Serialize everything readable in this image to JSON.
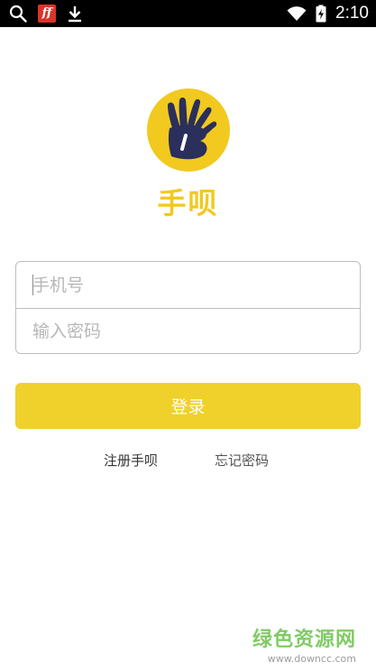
{
  "status_bar": {
    "left_icons": [
      "search-icon",
      "ff-app-icon",
      "download-icon"
    ],
    "ff_badge_text": "ff",
    "right_icons": [
      "wifi-icon",
      "battery-charging-icon"
    ],
    "time": "2:10"
  },
  "colors": {
    "brand_yellow": "#f2c91f",
    "logo_navy": "#2a2f5b",
    "border_gray": "#bdbdbd",
    "placeholder_gray": "#b7b7b7",
    "watermark_green": "#6bc34a"
  },
  "app": {
    "logo_icon": "hand-b-logo-icon",
    "name": "手呗"
  },
  "login_form": {
    "phone_placeholder": "手机号",
    "phone_value": "",
    "password_placeholder": "输入密码",
    "password_value": "",
    "submit_label": "登录"
  },
  "links": {
    "register": "注册手呗",
    "forgot_password": "忘记密码"
  },
  "watermark": {
    "text": "绿色资源网",
    "url": "www.downcc.com"
  }
}
